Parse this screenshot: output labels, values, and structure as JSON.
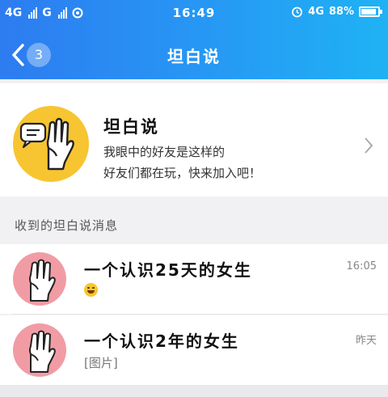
{
  "statusbar": {
    "network1": "4G",
    "network2": "G",
    "time": "16:49",
    "network3": "4G",
    "battery_text": "88%",
    "battery_level": 0.88
  },
  "titlebar": {
    "back_count": "3",
    "title": "坦白说"
  },
  "intro": {
    "title": "坦白说",
    "desc_line1": "我眼中的好友是这样的",
    "desc_line2": "好友们都在玩，快来加入吧！"
  },
  "section": {
    "label": "收到的坦白说消息"
  },
  "messages": [
    {
      "title": "一个认识25天的女生",
      "time": "16:05",
      "subtitle": ""
    },
    {
      "title": "一个认识2年的女生",
      "time": "昨天",
      "subtitle": "[图片]"
    }
  ],
  "colors": {
    "header_start": "#2d7cf0",
    "header_end": "#1fb2f4",
    "intro_logo": "#f7c531",
    "avatar": "#f19ca4"
  }
}
